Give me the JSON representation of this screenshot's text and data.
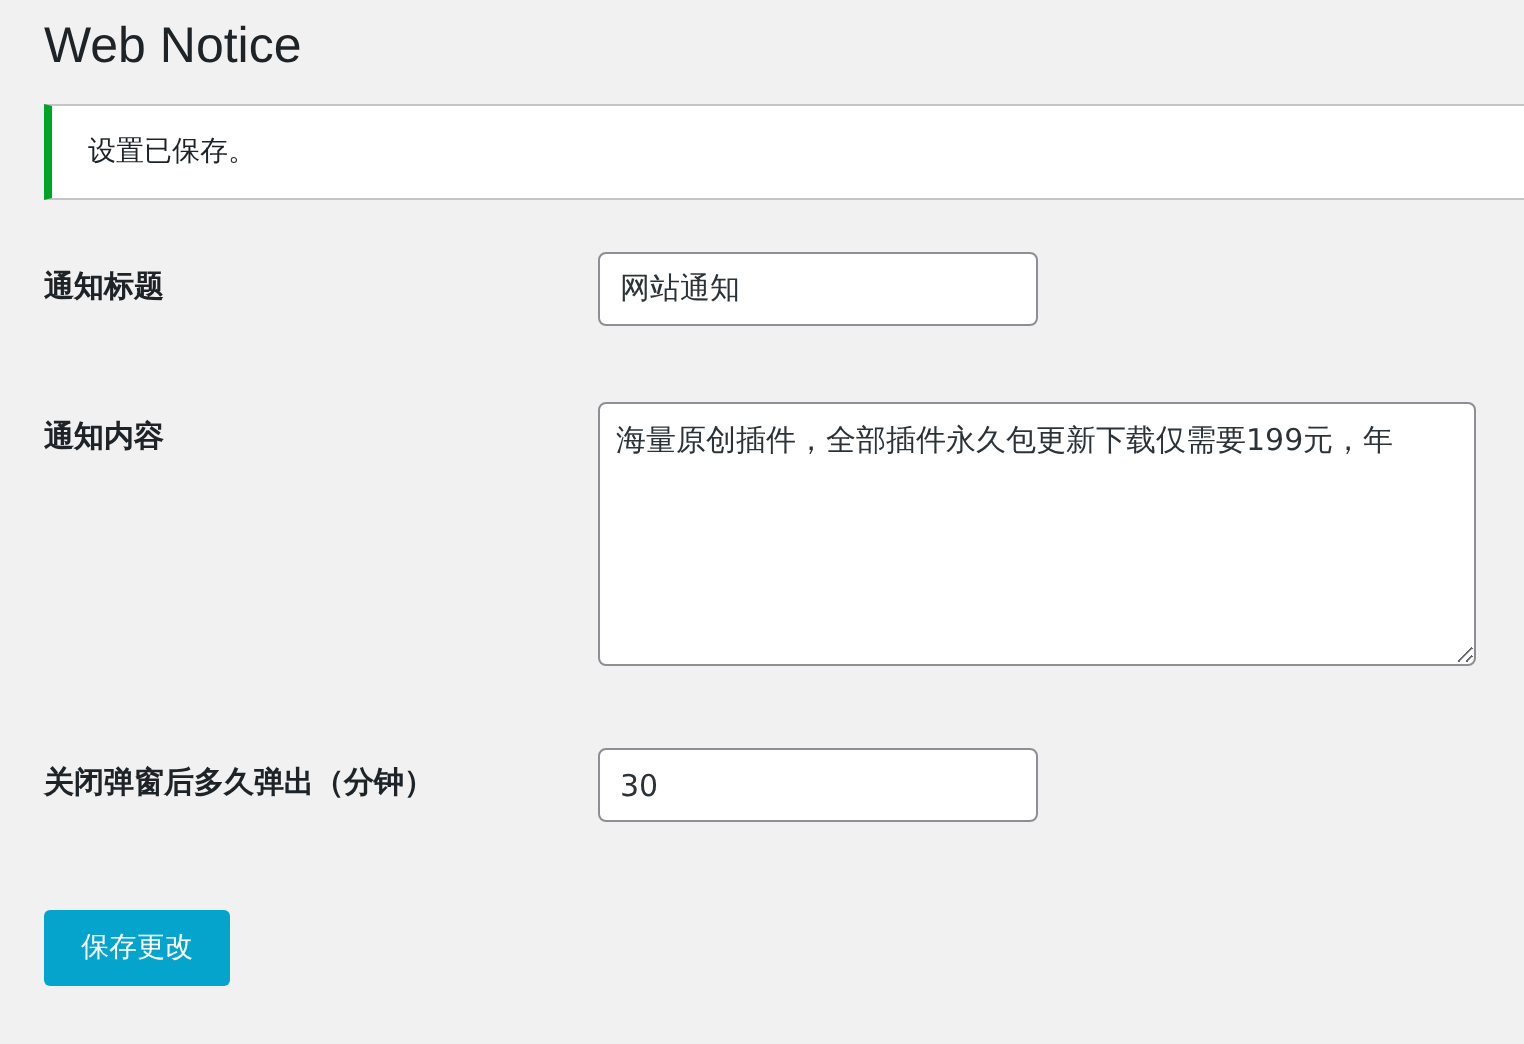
{
  "page_title": "Web Notice",
  "notice": {
    "message": "设置已保存。"
  },
  "fields": [
    {
      "kind": "input",
      "label": "通知标题",
      "value": "网站通知"
    },
    {
      "kind": "textarea",
      "label": "通知内容",
      "value": "海量原创插件，全部插件永久包更新下载仅需要199元，年"
    },
    {
      "kind": "input",
      "label": "关闭弹窗后多久弹出（分钟）",
      "value": "30"
    }
  ],
  "submit_button": "保存更改"
}
